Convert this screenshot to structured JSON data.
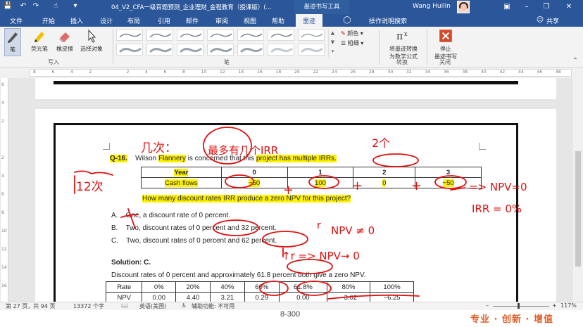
{
  "titlebar": {
    "quick_access": [
      "save-icon",
      "undo-icon",
      "redo-icon",
      "touch-mode-icon",
      "customize-icon"
    ],
    "document_title": "04_V2_CFA一级百题预测_企业理财_金程教育（授课版）(...",
    "context_tab": "墨迹书写工具",
    "user_name": "Wang Huilin",
    "window_buttons": [
      "ribbon-display-icon",
      "minimize-icon",
      "restore-icon",
      "close-icon"
    ]
  },
  "tabs": {
    "items": [
      "文件",
      "开始",
      "插入",
      "设计",
      "布局",
      "引用",
      "邮件",
      "审阅",
      "视图",
      "帮助",
      "墨迹"
    ],
    "active_index": 10,
    "tell_me": "操作说明搜索",
    "share": "共享"
  },
  "ribbon": {
    "write_group": {
      "pen_label": "笔",
      "highlighter_label": "荧光笔",
      "eraser_label": "橡皮擦",
      "select_label": "选择对象",
      "group_label": "写入"
    },
    "pens_group": {
      "group_label": "笔",
      "swatch_count": 14
    },
    "color_label": "颜色",
    "thickness_label": "粗细",
    "convert_group": {
      "button_label_1": "将墨迹转换",
      "button_label_2": "为数学公式",
      "group_label": "转换"
    },
    "close_group": {
      "button_label_1": "停止",
      "button_label_2": "墨迹书写",
      "group_label": "关闭"
    }
  },
  "ruler": {
    "numbers": [
      "8",
      "6",
      "4",
      "2",
      "",
      "2",
      "4",
      "6",
      "8",
      "10",
      "12",
      "14",
      "16",
      "18",
      "20",
      "22",
      "24",
      "26",
      "28",
      "30",
      "32",
      "34",
      "36",
      "38",
      "40",
      "42",
      "44",
      "46",
      "48"
    ]
  },
  "vruler": {
    "numbers": [
      "6",
      "4",
      "2",
      "",
      "2",
      "4",
      "6",
      "8",
      "10",
      "12",
      "14",
      "16"
    ]
  },
  "document": {
    "question_number": "Q-16.",
    "question_text_parts": [
      "Wilson ",
      "Flannery",
      " is concerned that this ",
      "project has multiple IRRs."
    ],
    "table": {
      "header_label": "Year",
      "years": [
        "0",
        "1",
        "2",
        "3"
      ],
      "row_label": "Cash flows",
      "cash_flows": [
        "−50",
        "100",
        "0",
        "−50"
      ]
    },
    "question_prompt": "How many discount rates IRR produce a zero NPV for this project?",
    "options": [
      {
        "letter": "A.",
        "text": "One, a discount rate of 0 percent."
      },
      {
        "letter": "B.",
        "text": "Two, discount rates of 0 percent and 32 percent."
      },
      {
        "letter": "C.",
        "text": "Two, discount rates of 0 percent and 62 percent."
      }
    ],
    "solution_label": "Solution: C.",
    "solution_text": "Discount rates of 0 percent and approximately 61.8 percent both give a zero NPV.",
    "rate_table": {
      "rate_label": "Rate",
      "rates": [
        "0%",
        "20%",
        "40%",
        "60%",
        "61.8%",
        "80%",
        "100%"
      ],
      "npv_label": "NPV",
      "npvs": [
        "0.00",
        "4.40",
        "3.21",
        "0.29",
        "0.00",
        "−3.02",
        "−6.25"
      ]
    },
    "page_footer": "8-300"
  },
  "handwriting": {
    "top_note": "几次：",
    "circled_note": "最多有几个IRR",
    "years_note": "2个",
    "left_note": "12次",
    "plus_signs": [
      "+",
      "+",
      "+"
    ],
    "npv_eq": "=> NPV=0",
    "irr_eq": "IRR = 0%",
    "r_label": "r",
    "npv_neq": "NPV ≠ 0",
    "r_arrow_note": "↑r => NPV→ 0"
  },
  "statusbar": {
    "page_info": "第 27 页，共 94 页",
    "word_count": "13372 个字",
    "language": "英语(美国)",
    "accessibility": "辅助功能: 不可用",
    "zoom_percent": "117%"
  },
  "overlay": {
    "slogan": "专业 · 创新 · 增值"
  },
  "colors": {
    "ribbon_blue": "#2b579a",
    "ink_red": "#e01010",
    "highlight_yellow": "#fff200",
    "slogan_orange": "#e0602a"
  }
}
